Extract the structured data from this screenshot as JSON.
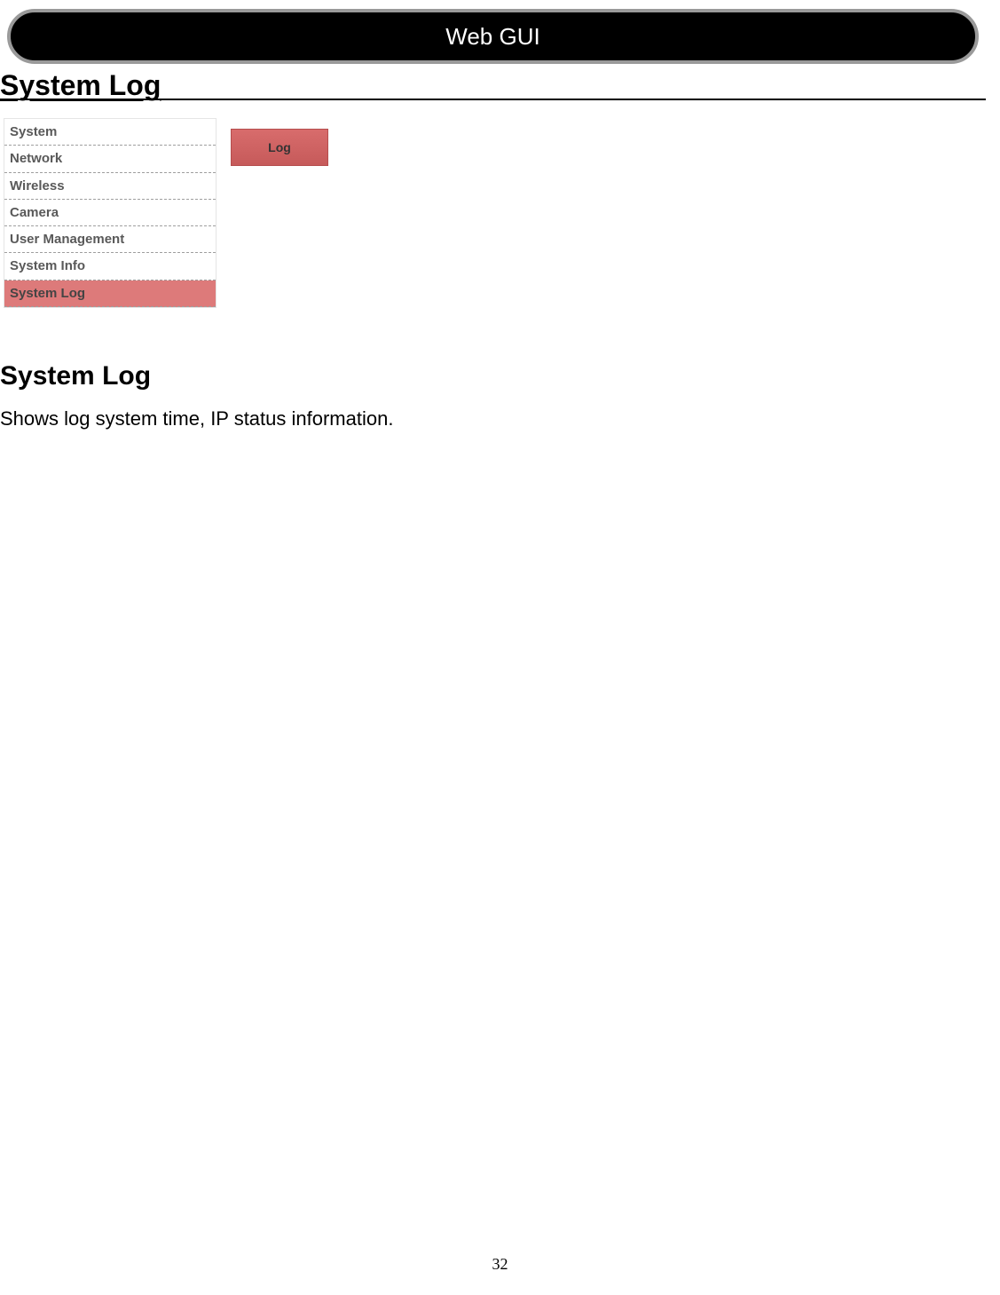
{
  "header": {
    "title": "Web GUI"
  },
  "section_title": "System Log",
  "sidebar": {
    "items": [
      {
        "label": "System",
        "active": false
      },
      {
        "label": "Network",
        "active": false
      },
      {
        "label": "Wireless",
        "active": false
      },
      {
        "label": "Camera",
        "active": false
      },
      {
        "label": "User Management",
        "active": false
      },
      {
        "label": "System Info",
        "active": false
      },
      {
        "label": "System Log",
        "active": true
      }
    ]
  },
  "tab": {
    "label": "Log"
  },
  "content": {
    "heading": "System Log",
    "body": "Shows log system time, IP status information."
  },
  "page_number": "32"
}
